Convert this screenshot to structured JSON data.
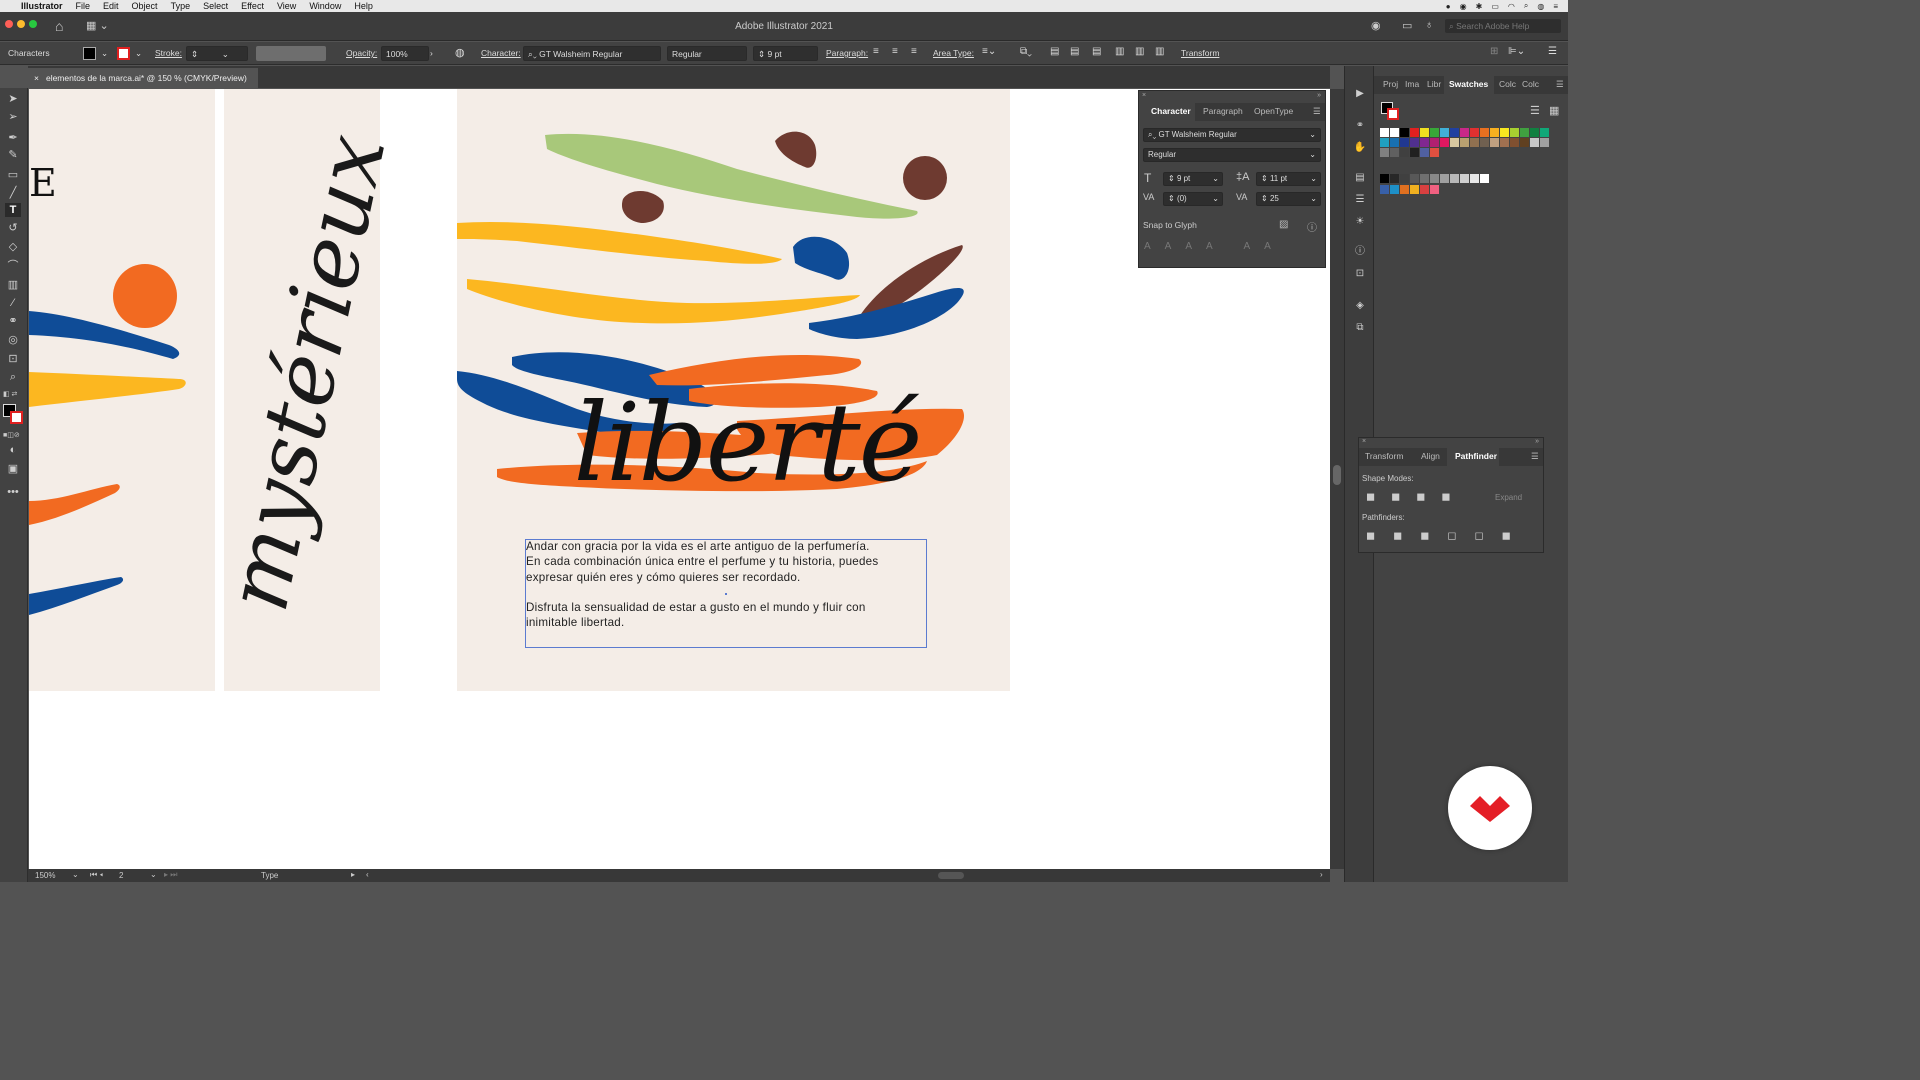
{
  "menubar": {
    "apple": "",
    "app_name": "Illustrator",
    "items": [
      "File",
      "Edit",
      "Object",
      "Type",
      "Select",
      "Effect",
      "View",
      "Window",
      "Help"
    ]
  },
  "window": {
    "title": "Adobe Illustrator 2021",
    "search_placeholder": "Search Adobe Help"
  },
  "control_bar": {
    "selection_label": "Characters",
    "stroke_label": "Stroke:",
    "opacity_label": "Opacity:",
    "opacity_value": "100%",
    "character_label": "Character:",
    "font_family": "GT Walsheim Regular",
    "font_style": "Regular",
    "font_size": "9 pt",
    "paragraph_label": "Paragraph:",
    "area_type_label": "Area Type:",
    "transform_label": "Transform"
  },
  "document_tab": {
    "close": "×",
    "title": "elementos de la marca.ai* @ 150 % (CMYK/Preview)"
  },
  "artboards": {
    "left_letter": "E",
    "vertical_word": "mystérieux",
    "script_word": "liberté",
    "paragraph_lines": [
      "Andar con gracia por la vida es el arte antiguo de la perfumería.",
      "En cada combinación única entre el perfume y tu historia, puedes",
      "expresar quién eres y  cómo quieres ser recordado.",
      "",
      "Disfruta la sensualidad de estar a gusto en el mundo y fluir con",
      "inimitable libertad."
    ]
  },
  "character_panel": {
    "tabs": [
      "Character",
      "Paragraph",
      "OpenType"
    ],
    "font_family": "GT Walsheim Regular",
    "font_style": "Regular",
    "font_size": "9 pt",
    "leading": "11 pt",
    "kerning": "(0)",
    "tracking": "25",
    "snap_label": "Snap to Glyph"
  },
  "swatches_panel": {
    "tabs": [
      "Proj",
      "Ima",
      "Libr",
      "Swatches",
      "Colc",
      "Colc"
    ],
    "colors": [
      "#ffffff",
      "#ffffff",
      "#000000",
      "#e02020",
      "#f0e020",
      "#38a838",
      "#40b0d8",
      "#2040a0",
      "#c82888",
      "#e03030",
      "#e87020",
      "#f8b020",
      "#f8e820",
      "#a8d030",
      "#40a040",
      "#108040",
      "#10a878",
      "#20a0c0",
      "#1870b0",
      "#203890",
      "#503090",
      "#802890",
      "#b02070",
      "#e01860",
      "#d8c8a0",
      "#b8a070",
      "#907050",
      "#706050",
      "#c0a080",
      "#a07050",
      "#805030",
      "#604020",
      "#c8c8c8",
      "#a0a0a0",
      "#808080",
      "#606060",
      "#404040",
      "#202020",
      "#5060a0",
      "#e05040"
    ],
    "grays": [
      "#000000",
      "#282828",
      "#404040",
      "#585858",
      "#707070",
      "#888888",
      "#a0a0a0",
      "#b8b8b8",
      "#d0d0d0",
      "#e8e8e8",
      "#ffffff"
    ],
    "brand": [
      "#3860a8",
      "#1e90c8",
      "#e07020",
      "#f0b020",
      "#d84040",
      "#f06080"
    ]
  },
  "pathfinder_panel": {
    "tabs": [
      "Transform",
      "Align",
      "Pathfinder"
    ],
    "shape_modes_label": "Shape Modes:",
    "expand_label": "Expand",
    "pathfinders_label": "Pathfinders:"
  },
  "status_bar": {
    "zoom": "150%",
    "artboard_num": "2",
    "tool": "Type"
  },
  "colors": {
    "orange": "#f26a21",
    "yellow": "#fcb720",
    "blue": "#0f4c97",
    "green": "#a8c87a",
    "brown": "#6e3a30",
    "artboard": "#f4ede7",
    "brand_red": "#e41e26"
  }
}
